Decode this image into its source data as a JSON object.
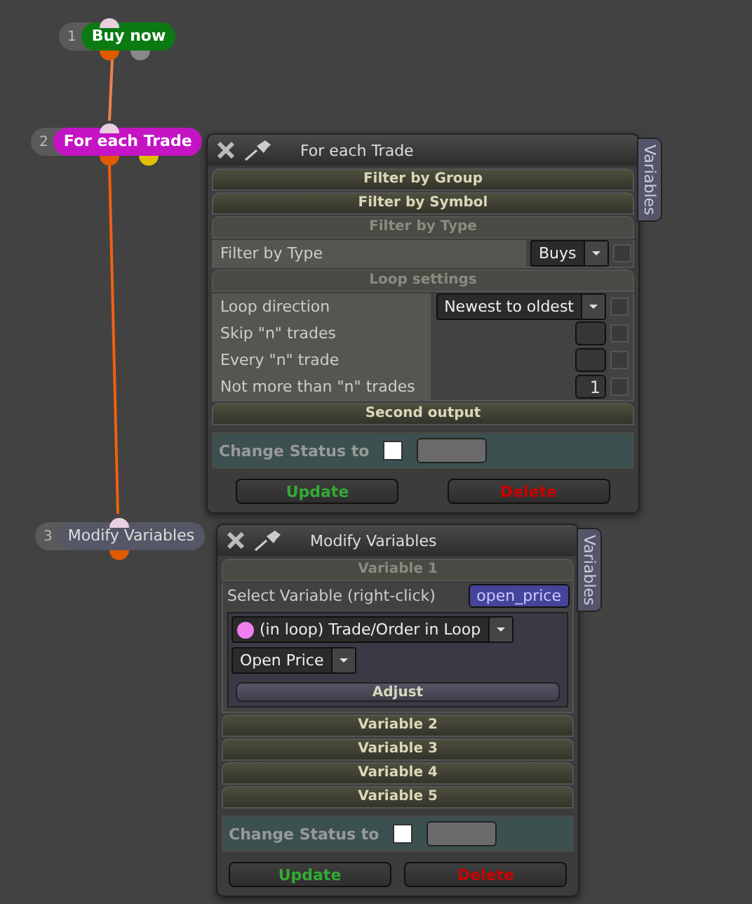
{
  "nodes": [
    {
      "number": "1",
      "label": "Buy now",
      "color": "#0b7a12"
    },
    {
      "number": "2",
      "label": "For each Trade",
      "color": "#c414c4"
    },
    {
      "number": "3",
      "label": "Modify Variables",
      "color": "#555766"
    }
  ],
  "panels": [
    {
      "title": "For each Trade",
      "side_tab": "Variables",
      "sections": [
        {
          "title": "Filter by Group",
          "expanded": false
        },
        {
          "title": "Filter by Symbol",
          "expanded": false
        },
        {
          "title": "Filter by Type",
          "expanded": true,
          "rows": [
            {
              "label": "Filter by Type",
              "kind": "dropdown",
              "value": "Buys",
              "checked": false
            }
          ]
        },
        {
          "title": "Loop settings",
          "expanded": true,
          "rows": [
            {
              "label": "Loop direction",
              "kind": "dropdown",
              "value": "Newest to oldest",
              "checked": false
            },
            {
              "label": "Skip \"n\" trades",
              "kind": "number",
              "checked": false
            },
            {
              "label": "Every \"n\" trade",
              "kind": "number",
              "checked": false
            },
            {
              "label": "Not more than \"n\" trades",
              "kind": "number",
              "value": "1",
              "checked": false
            }
          ]
        },
        {
          "title": "Second output",
          "expanded": false
        }
      ],
      "status": {
        "label": "Change Status to",
        "checked": false
      },
      "buttons": [
        {
          "label": "Update",
          "kind": "update"
        },
        {
          "label": "Delete",
          "kind": "delete"
        }
      ]
    },
    {
      "title": "Modify Variables",
      "side_tab": "Variables",
      "sections": [
        {
          "title": "Variable 1",
          "expanded": true,
          "variable": {
            "label": "Select Variable (right-click)",
            "name": "open_price",
            "source": {
              "label": "(in loop) Trade/Order in Loop",
              "color": "#f080f0"
            },
            "property": "Open Price",
            "adjust": "Adjust"
          }
        },
        {
          "title": "Variable 2",
          "expanded": false
        },
        {
          "title": "Variable 3",
          "expanded": false
        },
        {
          "title": "Variable 4",
          "expanded": false
        },
        {
          "title": "Variable 5",
          "expanded": false
        }
      ],
      "status": {
        "label": "Change Status to",
        "checked": false
      },
      "buttons": [
        {
          "label": "Update",
          "kind": "update"
        },
        {
          "label": "Delete",
          "kind": "delete"
        }
      ]
    }
  ]
}
